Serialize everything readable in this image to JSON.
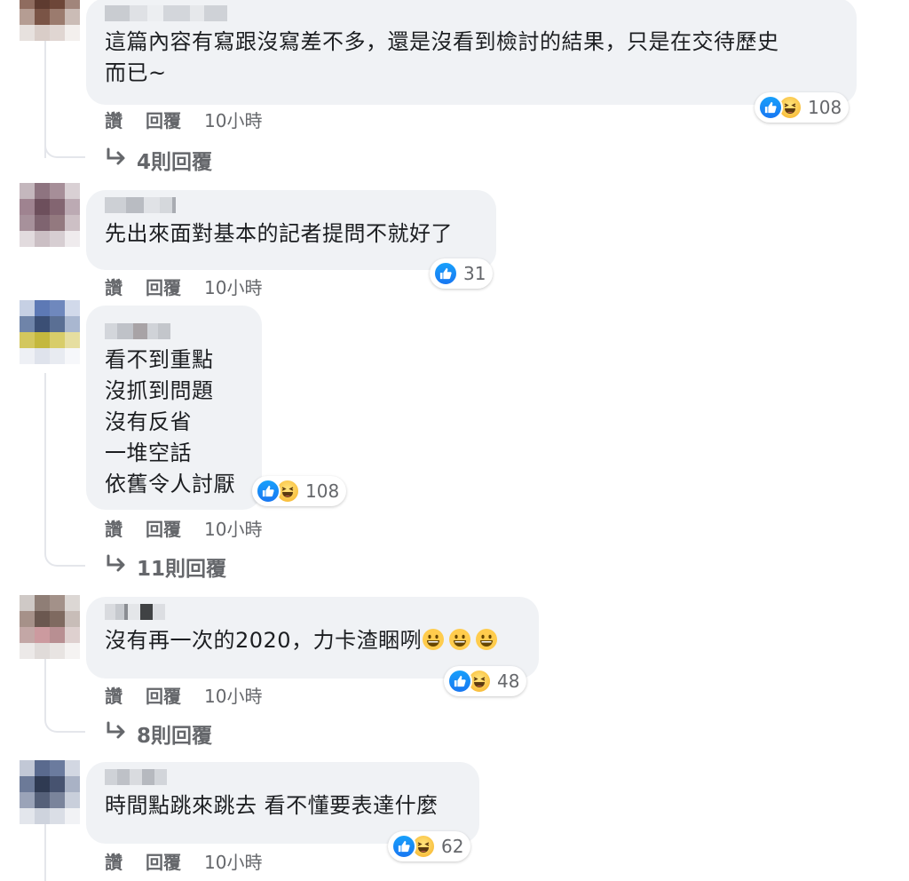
{
  "comments": [
    {
      "text": "這篇內容有寫跟沒寫差不多，還是沒看到檢討的結果，只是在交待歷史\n而已~",
      "reaction_count": "108",
      "reactions": [
        "like-icon",
        "haha-icon"
      ],
      "like_label": "讚",
      "reply_label": "回覆",
      "time": "10小時",
      "view_replies": "4則回覆"
    },
    {
      "text": "先出來面對基本的記者提問不就好了",
      "reaction_count": "31",
      "reactions": [
        "like-icon"
      ],
      "like_label": "讚",
      "reply_label": "回覆",
      "time": "10小時"
    },
    {
      "text": "看不到重點\n沒抓到問題\n沒有反省\n一堆空話\n依舊令人討厭",
      "reaction_count": "108",
      "reactions": [
        "like-icon",
        "haha-icon"
      ],
      "like_label": "讚",
      "reply_label": "回覆",
      "time": "10小時",
      "view_replies": "11則回覆"
    },
    {
      "text": "沒有再一次的2020，力卡渣睏咧",
      "emoji_suffix": [
        "grinning-emoji",
        "grinning-emoji",
        "grinning-emoji"
      ],
      "reaction_count": "48",
      "reactions": [
        "like-icon",
        "haha-icon"
      ],
      "like_label": "讚",
      "reply_label": "回覆",
      "time": "10小時",
      "view_replies": "8則回覆"
    },
    {
      "text": "時間點跳來跳去 看不懂要表達什麼",
      "reaction_count": "62",
      "reactions": [
        "like-icon",
        "haha-icon"
      ],
      "like_label": "讚",
      "reply_label": "回覆",
      "time": "10小時"
    }
  ],
  "colors": {
    "bubble": "#f0f2f5",
    "like_blue": "#1877f2",
    "meta_gray": "#65676b"
  }
}
